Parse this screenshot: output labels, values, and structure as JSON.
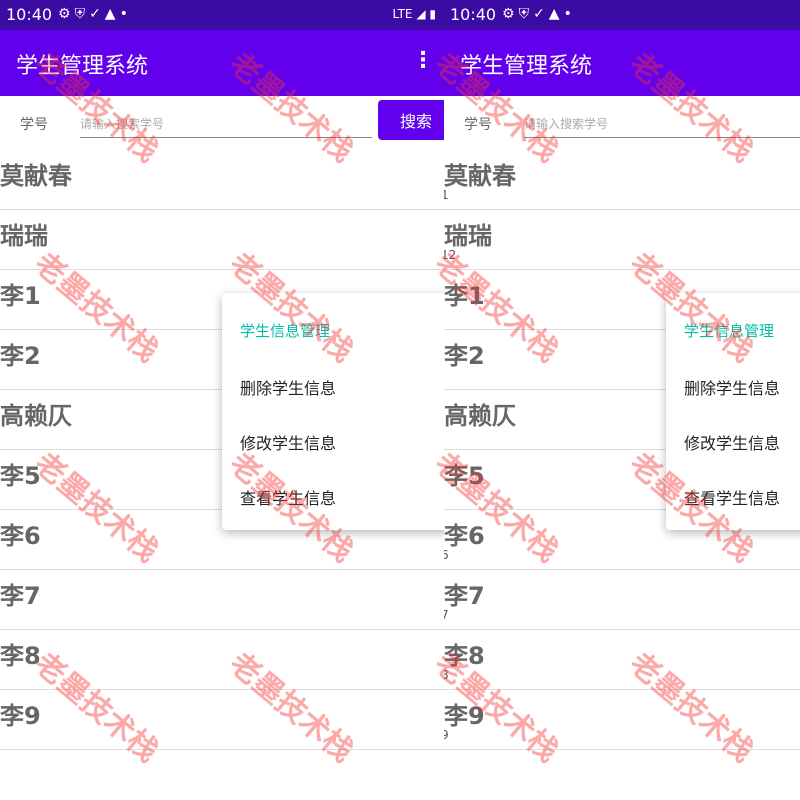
{
  "status": {
    "time": "10:40",
    "network": "LTE"
  },
  "app": {
    "title": "学生管理系统",
    "overflow_glyph": "⋮"
  },
  "search": {
    "label": "学号",
    "placeholder_left": "请输入搜索学号",
    "placeholder_right": "请输入搜索学号",
    "button": "搜索"
  },
  "students": [
    {
      "name": "莫献春",
      "extra": "1"
    },
    {
      "name": "瑞瑞",
      "extra": "12"
    },
    {
      "name": "李1",
      "extra": ""
    },
    {
      "name": "李2",
      "extra": ""
    },
    {
      "name": "高赖仄",
      "extra": ""
    },
    {
      "name": "李5",
      "extra": ""
    },
    {
      "name": "李6",
      "extra": "6"
    },
    {
      "name": "李7",
      "extra": "7"
    },
    {
      "name": "李8",
      "extra": "8"
    },
    {
      "name": "李9",
      "extra": "9"
    }
  ],
  "context_menu": {
    "header": "学生信息管理",
    "items": [
      "删除学生信息",
      "修改学生信息",
      "查看学生信息"
    ]
  },
  "watermark": "老墨技术栈",
  "colors": {
    "status_bar": "#3a0ca3",
    "app_bar": "#6200ee",
    "button": "#6200ee",
    "menu_header": "#00bfa5",
    "watermark": "#f53232"
  },
  "icons": {
    "status_left": [
      "gear-icon",
      "shield-icon",
      "check-icon",
      "signal-icon",
      "dot-icon"
    ],
    "status_right": [
      "lte-icon",
      "signal-icon",
      "battery-icon"
    ],
    "overflow": "more-vert-icon"
  }
}
